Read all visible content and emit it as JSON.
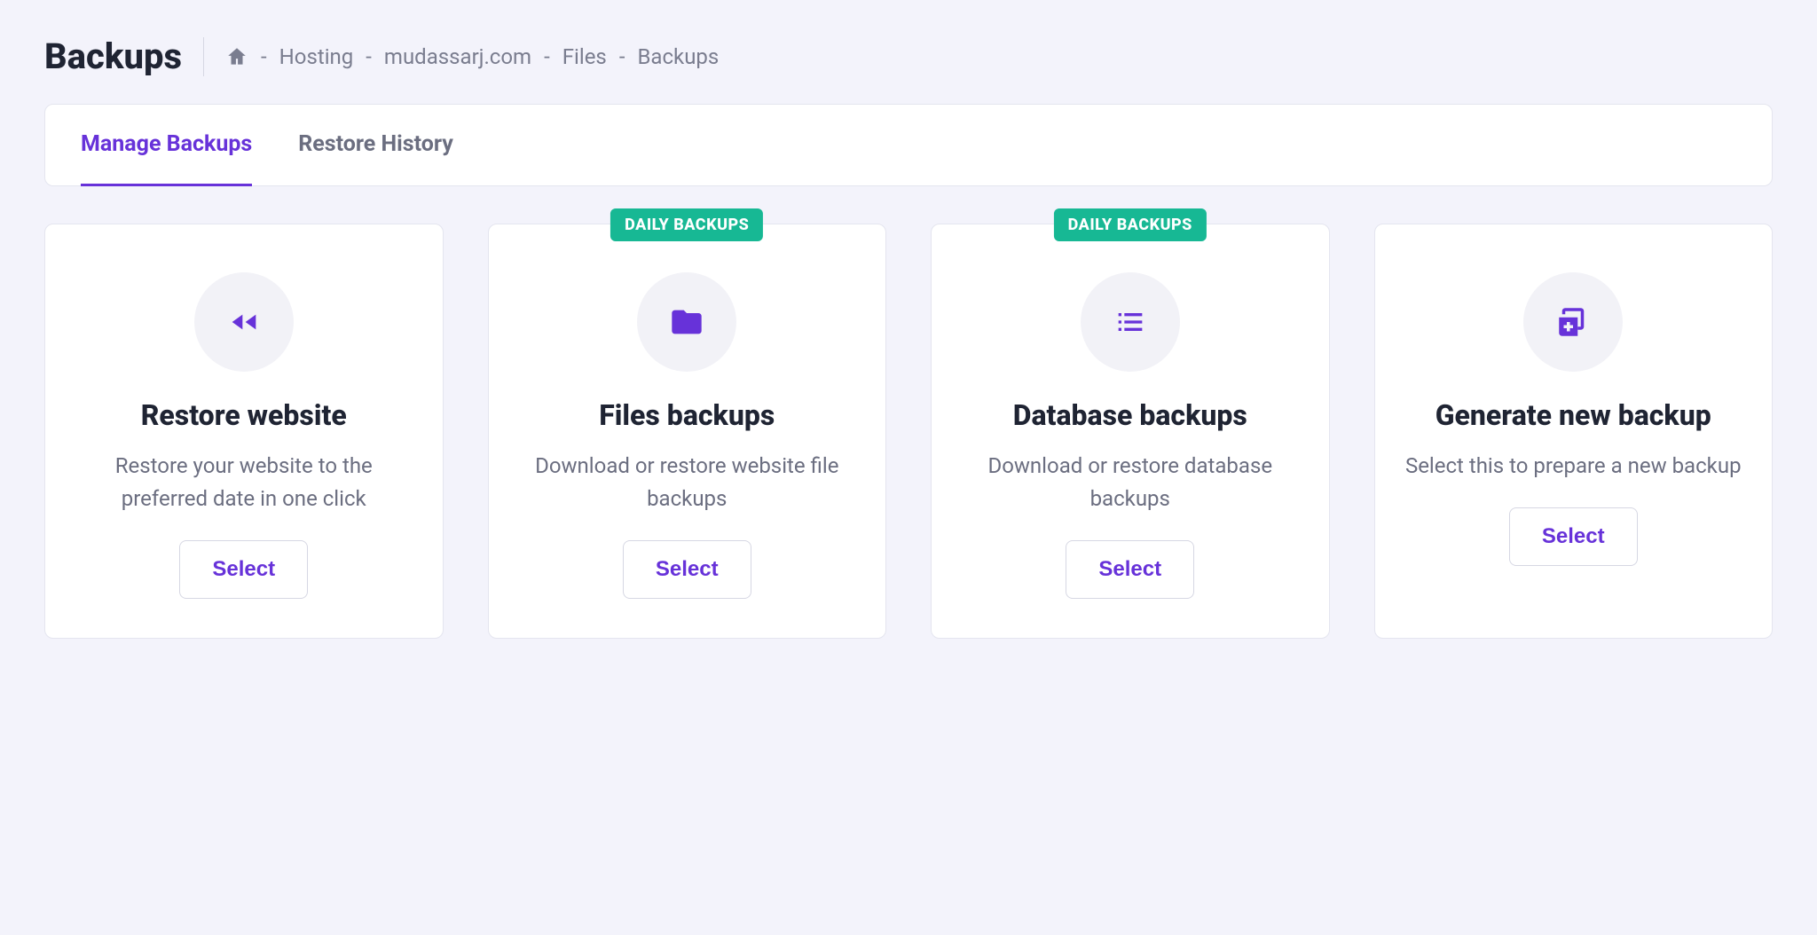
{
  "page": {
    "title": "Backups"
  },
  "breadcrumb": {
    "items": [
      "Hosting",
      "mudassarj.com",
      "Files",
      "Backups"
    ],
    "separator": "-"
  },
  "tabs": [
    {
      "label": "Manage Backups",
      "active": true
    },
    {
      "label": "Restore History",
      "active": false
    }
  ],
  "badge_text": "DAILY BACKUPS",
  "cards": [
    {
      "icon": "rewind-icon",
      "title": "Restore website",
      "description": "Restore your website to the preferred date in one click",
      "button": "Select",
      "badge": false
    },
    {
      "icon": "folder-icon",
      "title": "Files backups",
      "description": "Download or restore website file backups",
      "button": "Select",
      "badge": true
    },
    {
      "icon": "list-icon",
      "title": "Database backups",
      "description": "Download or restore database backups",
      "button": "Select",
      "badge": true
    },
    {
      "icon": "add-copy-icon",
      "title": "Generate new backup",
      "description": "Select this to prepare a new backup",
      "button": "Select",
      "badge": false
    }
  ],
  "colors": {
    "accent": "#6732d9",
    "badge": "#17b894",
    "muted": "#6b6e80",
    "bg": "#f3f3fb"
  }
}
